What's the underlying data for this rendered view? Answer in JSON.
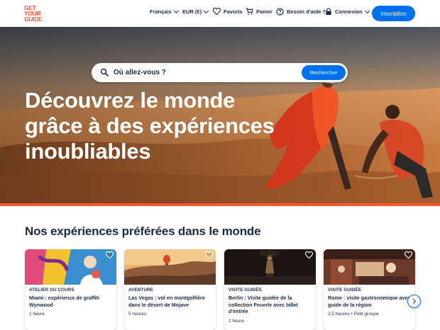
{
  "brand": {
    "logo_lines": [
      "GET",
      "YOUR",
      "GUIDE"
    ],
    "accent": "#ff5533",
    "primary": "#0071eb",
    "text": "#1a2b49"
  },
  "header": {
    "language": "Français",
    "currency": "EUR (€)",
    "wishlist": "Favoris",
    "cart": "Panier",
    "help": "Besoin d'aide ?",
    "login": "Connexion",
    "signup": "Inscription"
  },
  "search": {
    "placeholder": "Où allez-vous ?",
    "button": "Rechercher"
  },
  "hero": {
    "title": "Découvrez le monde grâce à des expériences inoubliables"
  },
  "section": {
    "title": "Nos expériences préférées dans le monde"
  },
  "cards": [
    {
      "category": "Atelier ou cours",
      "title": "Miami : expérience de graffiti Wynwood",
      "meta": "1 heure"
    },
    {
      "category": "Aventure",
      "title": "Las Vegas : vol en montgolfière dans le désert de Mojave",
      "meta": "5 heures"
    },
    {
      "category": "Visite guidée",
      "title": "Berlin : Visite guidée de la collection Feuerle avec billet d'entrée",
      "meta": "1 heure"
    },
    {
      "category": "Visite guidée",
      "title": "Rome : visite gastronomique avec guide de la région",
      "meta": "2,5 heures • Petit groupe"
    }
  ],
  "icons": {
    "search": "search-icon",
    "wishlist": "heart-icon",
    "cart": "cart-icon",
    "help": "help-circle-icon",
    "login": "lock-icon",
    "carousel_next": "chevron-right-icon"
  }
}
